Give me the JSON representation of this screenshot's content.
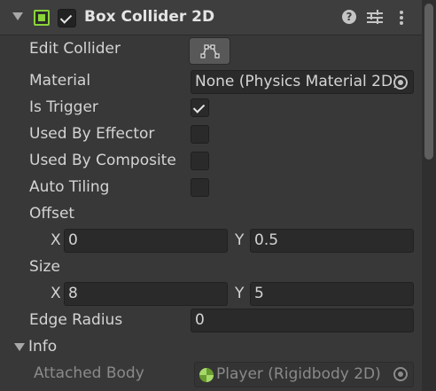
{
  "component": {
    "title": "Box Collider 2D",
    "enabled": true,
    "expanded": true,
    "icon": "box-collider-2d-icon",
    "accent_color": "#8ad43a"
  },
  "header_icons": [
    "help-icon",
    "presets-icon",
    "more-icon"
  ],
  "fields": {
    "edit_collider": {
      "label": "Edit Collider",
      "icon": "edit-collider-icon"
    },
    "material": {
      "label": "Material",
      "value": "None (Physics Material 2D)"
    },
    "is_trigger": {
      "label": "Is Trigger",
      "checked": true
    },
    "used_by_effector": {
      "label": "Used By Effector",
      "checked": false
    },
    "used_by_composite": {
      "label": "Used By Composite",
      "checked": false
    },
    "auto_tiling": {
      "label": "Auto Tiling",
      "checked": false
    },
    "offset": {
      "label": "Offset",
      "x_label": "X",
      "x": "0",
      "y_label": "Y",
      "y": "0.5"
    },
    "size": {
      "label": "Size",
      "x_label": "X",
      "x": "8",
      "y_label": "Y",
      "y": "5"
    },
    "edge_radius": {
      "label": "Edge Radius",
      "value": "0"
    }
  },
  "info": {
    "label": "Info",
    "expanded": true,
    "attached_body": {
      "label": "Attached Body",
      "value": "Player (Rigidbody 2D)",
      "icon": "rigidbody-2d-icon"
    }
  }
}
